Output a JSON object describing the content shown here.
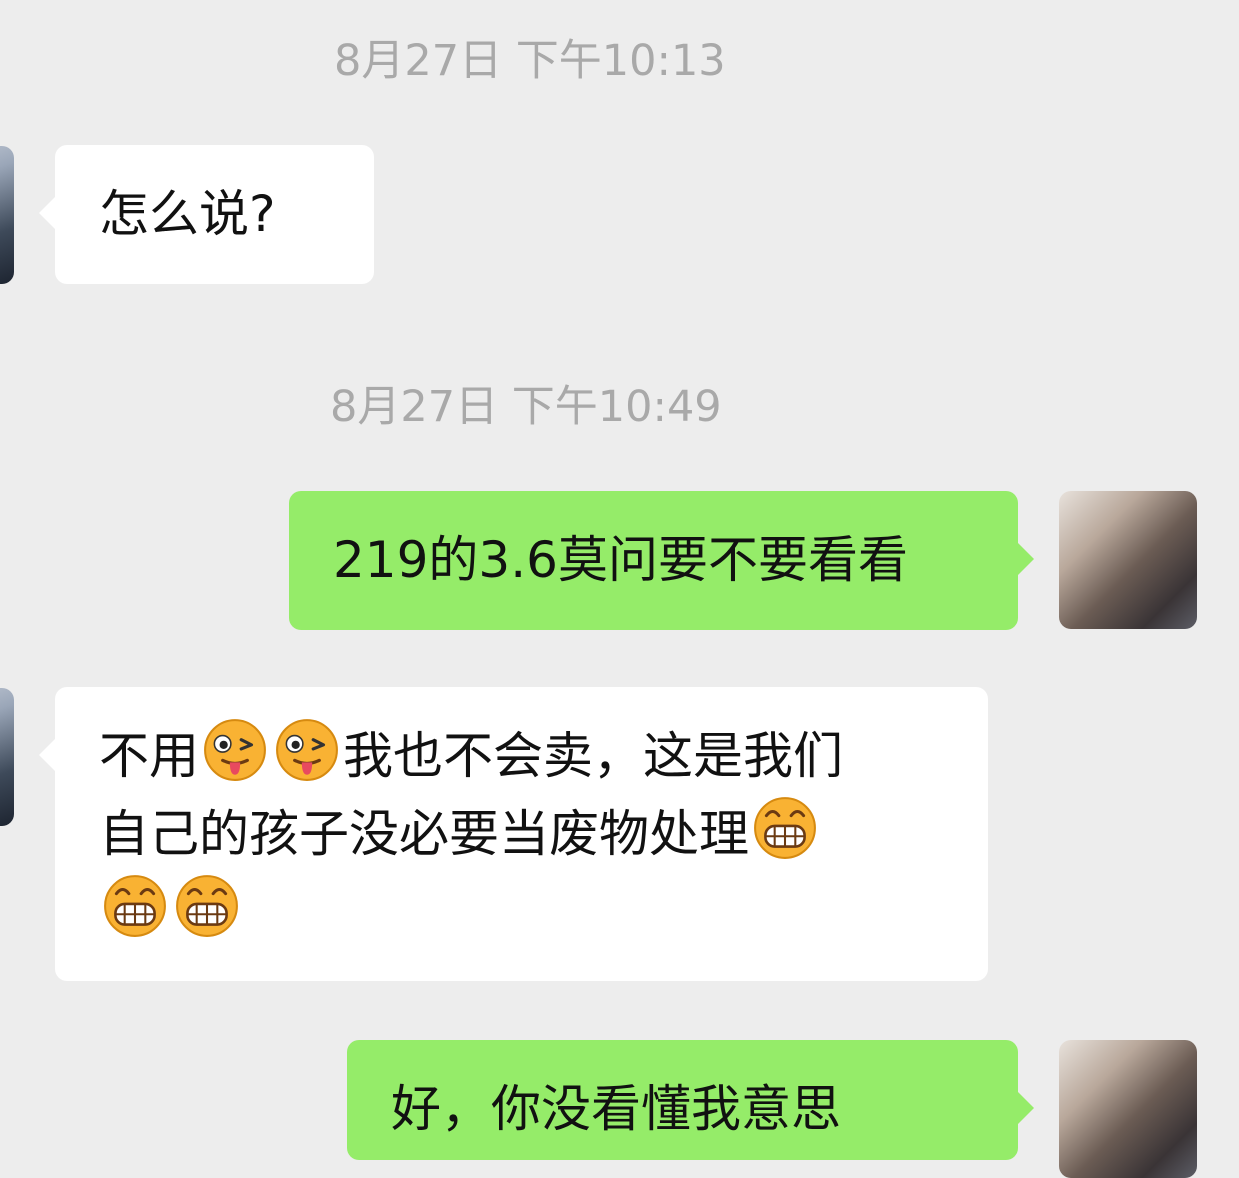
{
  "chat": {
    "timestamps": [
      "8月27日 下午10:13",
      "8月27日 下午10:49"
    ],
    "messages": [
      {
        "side": "left",
        "text": "怎么说?"
      },
      {
        "side": "right",
        "text": "219的3.6莫问要不要看看"
      },
      {
        "side": "left",
        "line1_a": "不用",
        "line1_b": "我也不会卖，这是我们",
        "line2": "自己的孩子没必要当废物处理",
        "emojis": [
          "winking-tongue-face",
          "winking-tongue-face",
          "grinning-face",
          "grinning-face",
          "grinning-face"
        ]
      },
      {
        "side": "right",
        "text": "好，你没看懂我意思"
      }
    ]
  },
  "colors": {
    "background": "#ededed",
    "incoming_bubble": "#ffffff",
    "outgoing_bubble": "#95ec69",
    "timestamp_text": "#a9a9a9"
  }
}
